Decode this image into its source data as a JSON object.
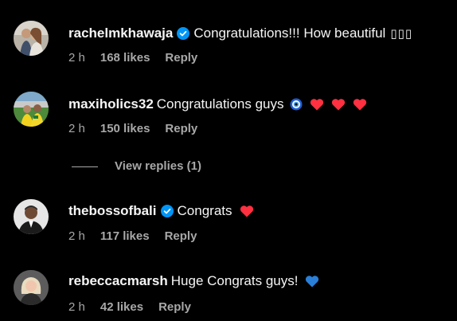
{
  "comments": [
    {
      "username": "rachelmkhawaja",
      "verified": true,
      "text": "Congratulations!!! How beautiful",
      "emoji": "▯▯▯",
      "time": "2 h",
      "likes": "168 likes",
      "reply": "Reply"
    },
    {
      "username": "maxiholics32",
      "verified": false,
      "text": "Congratulations guys",
      "emoji": "nazar-amulet, red-heart, red-heart, red-heart",
      "time": "2 h",
      "likes": "150 likes",
      "reply": "Reply"
    },
    {
      "username": "thebossofbali",
      "verified": true,
      "text": "Congrats",
      "emoji": "red-heart",
      "time": "2 h",
      "likes": "117 likes",
      "reply": "Reply"
    },
    {
      "username": "rebeccacmarsh",
      "verified": false,
      "text": "Huge Congrats guys!",
      "emoji": "blue-heart",
      "time": "2 h",
      "likes": "42 likes",
      "reply": "Reply"
    }
  ],
  "view_replies": "View replies (1)",
  "colors": {
    "background": "#000000",
    "primary_text": "#f5f5f5",
    "secondary_text": "#a8a8a8",
    "verified_blue": "#0095f6",
    "heart_red": "#ff3040",
    "heart_blue": "#2a7fd8"
  }
}
